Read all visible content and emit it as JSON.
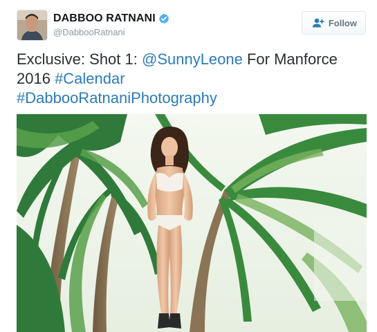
{
  "user": {
    "display_name": "DABBOO RATNANI",
    "handle": "@DabbooRatnani",
    "verified_icon": "verified-badge-icon",
    "accent_color": "#55acee"
  },
  "follow_button": {
    "label": "Follow",
    "icon": "add-user-icon"
  },
  "tweet": {
    "text_parts": {
      "p1": "Exclusive: Shot 1: ",
      "mention": "@SunnyLeone",
      "p2": " For Manforce 2016 ",
      "hashtag1": "#Calendar",
      "hashtag2": "#DabbooRatnaniPhotography"
    },
    "link_color": "#2b7bb9"
  },
  "media": {
    "kind": "photo"
  }
}
